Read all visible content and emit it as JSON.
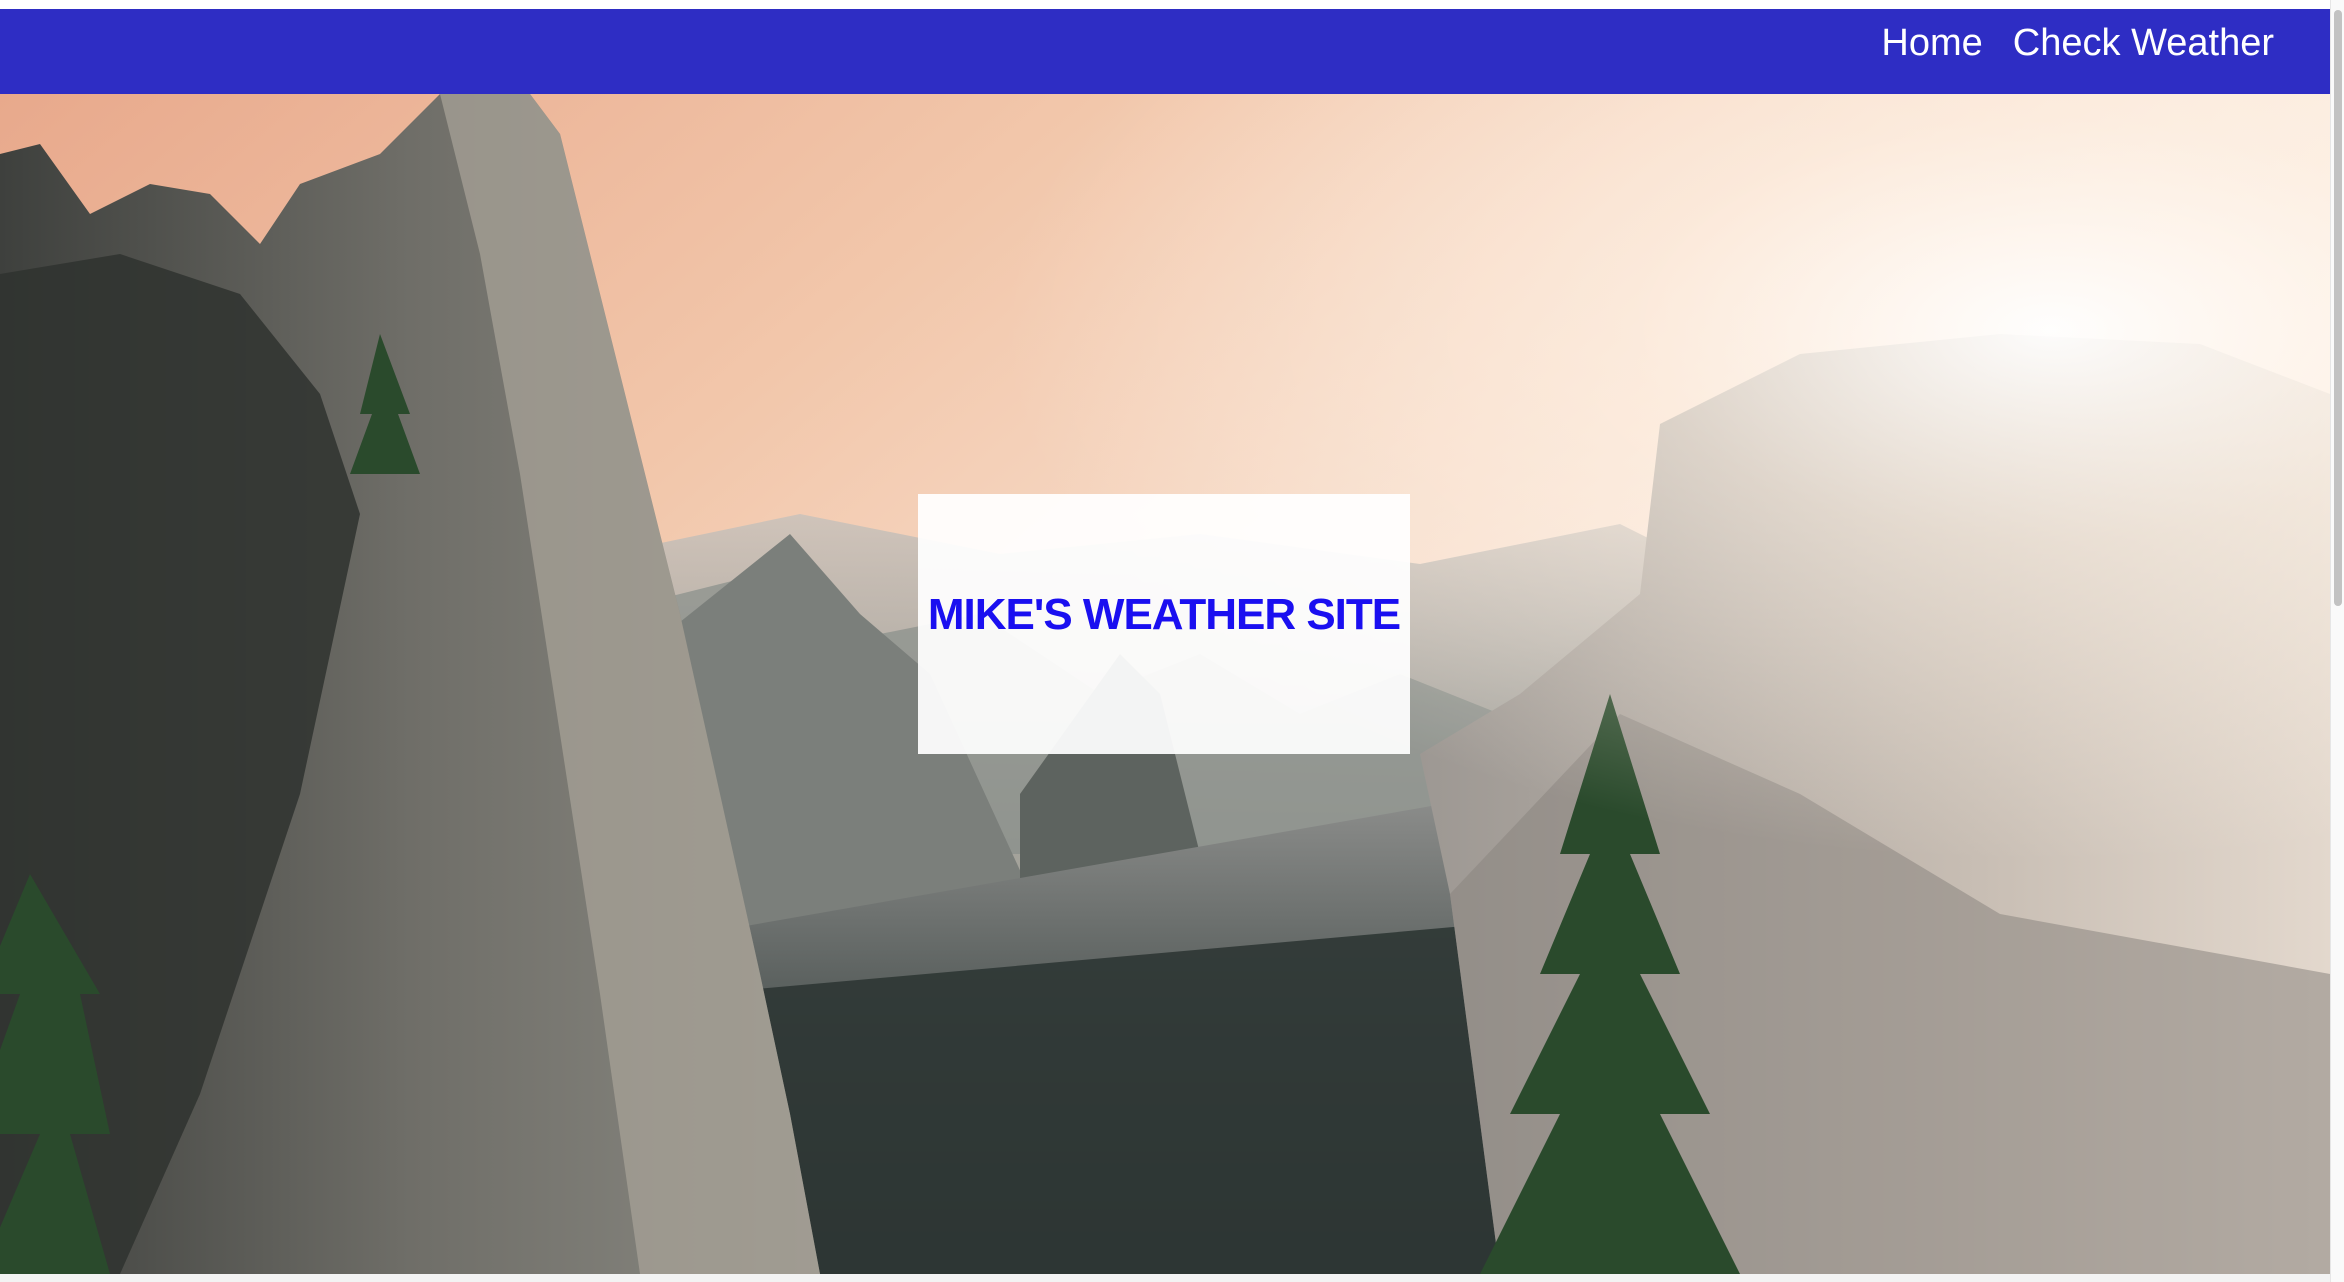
{
  "nav": {
    "links": [
      {
        "label": "Home"
      },
      {
        "label": "Check Weather"
      }
    ],
    "background_color": "#2e2dc4"
  },
  "hero": {
    "title": "MIKE'S WEATHER SITE",
    "title_color": "#1a0ff0",
    "background_scene": "mountain-valley-sunrise-photo"
  }
}
